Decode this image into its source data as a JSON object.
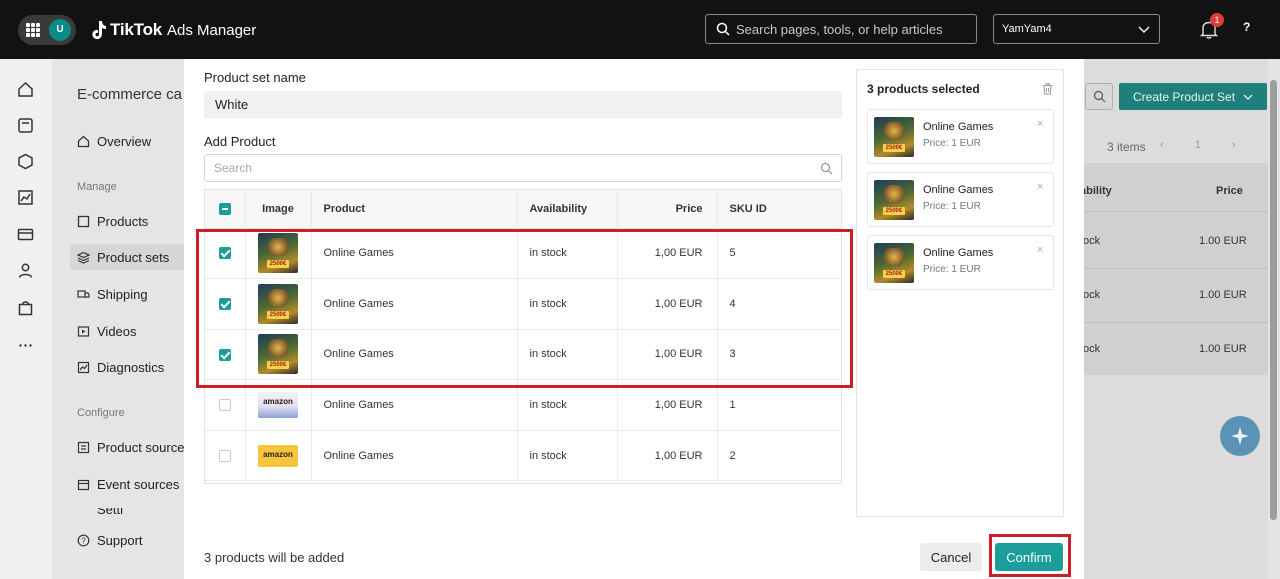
{
  "topbar": {
    "user_initial": "U",
    "brand": "TikTok",
    "product": "Ads Manager",
    "search_placeholder": "Search pages, tools, or help articles",
    "account": "YamYam4",
    "notification_count": "1",
    "help": "?"
  },
  "background": {
    "page_title": "E-commerce ca",
    "nav": {
      "overview": "Overview",
      "manage_section": "Manage",
      "products": "Products",
      "product_sets": "Product sets",
      "shipping": "Shipping",
      "videos": "Videos",
      "diagnostics": "Diagnostics",
      "configure_section": "Configure",
      "product_sources": "Product sources",
      "event_sources": "Event sources",
      "cut_item": "Setti",
      "support": "Support"
    },
    "create_button": "Create Product Set",
    "items_count": "3 items",
    "page_number": "1",
    "col_availability": "ability",
    "col_price": "Price",
    "rows": [
      {
        "availability": "ock",
        "price": "1.00 EUR"
      },
      {
        "availability": "ock",
        "price": "1.00 EUR"
      },
      {
        "availability": "ock",
        "price": "1.00 EUR"
      }
    ]
  },
  "modal": {
    "set_name_label": "Product set name",
    "set_name_value": "White",
    "add_product_label": "Add Product",
    "search_placeholder": "Search",
    "columns": {
      "image": "Image",
      "product": "Product",
      "availability": "Availability",
      "price": "Price",
      "sku": "SKU ID"
    },
    "rows": [
      {
        "checked": true,
        "thumb": "game",
        "product": "Online Games",
        "availability": "in stock",
        "price": "1,00 EUR",
        "sku": "5"
      },
      {
        "checked": true,
        "thumb": "game",
        "product": "Online Games",
        "availability": "in stock",
        "price": "1,00 EUR",
        "sku": "4"
      },
      {
        "checked": true,
        "thumb": "game",
        "product": "Online Games",
        "availability": "in stock",
        "price": "1,00 EUR",
        "sku": "3"
      },
      {
        "checked": false,
        "thumb": "amazon-banner",
        "product": "Online Games",
        "availability": "in stock",
        "price": "1,00 EUR",
        "sku": "1"
      },
      {
        "checked": false,
        "thumb": "amazon-yellow",
        "product": "Online Games",
        "availability": "in stock",
        "price": "1,00 EUR",
        "sku": "2"
      }
    ],
    "thumb_text": {
      "badge": "2500€",
      "amazon": "amazon"
    },
    "selected": {
      "title": "3 products selected",
      "items": [
        {
          "name": "Online Games",
          "price": "Price: 1 EUR"
        },
        {
          "name": "Online Games",
          "price": "Price: 1 EUR"
        },
        {
          "name": "Online Games",
          "price": "Price: 1 EUR"
        }
      ]
    },
    "footer_text": "3 products will be added",
    "cancel_label": "Cancel",
    "confirm_label": "Confirm"
  },
  "colors": {
    "accent": "#1b9e9a",
    "highlight": "#cc2027",
    "topbar": "#121212"
  }
}
